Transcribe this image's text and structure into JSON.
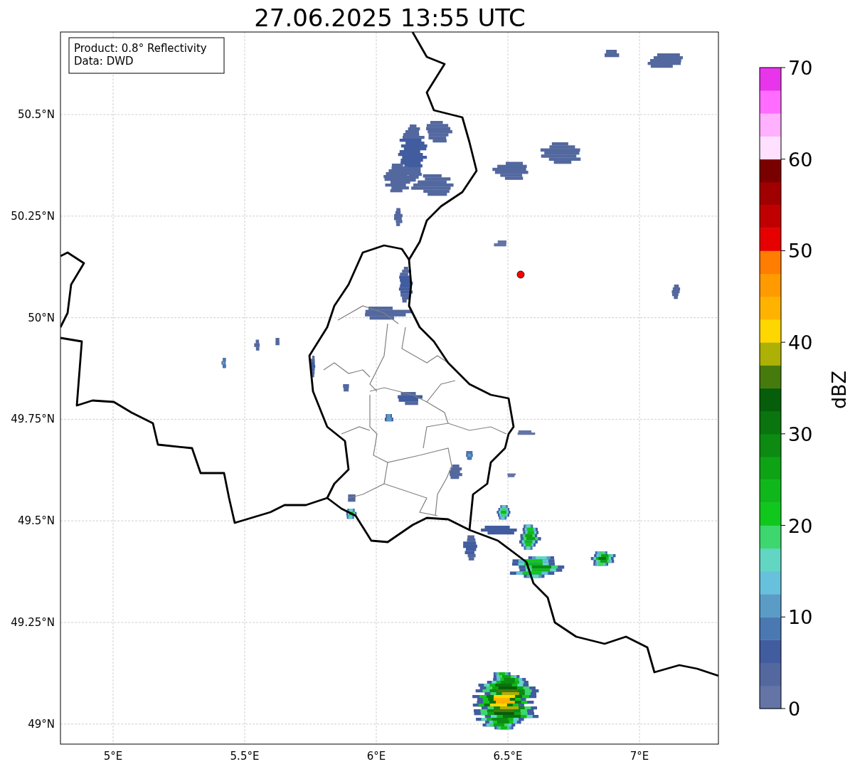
{
  "title": "27.06.2025 13:55 UTC",
  "legend": [
    "Product: 0.8° Reflectivity",
    "Data: DWD"
  ],
  "map": {
    "yticks": [
      "50.5°N",
      "50.25°N",
      "50°N",
      "49.75°N",
      "49.5°N",
      "49.25°N",
      "49°N"
    ],
    "xticks": [
      "5°E",
      "5.5°E",
      "6°E",
      "6.5°E",
      "7°E"
    ]
  },
  "colorbar": {
    "label": "dBZ",
    "ticks": [
      "70",
      "60",
      "50",
      "40",
      "30",
      "20",
      "10",
      "0"
    ],
    "bins": [
      {
        "color": "#6474a6"
      },
      {
        "color": "#53689f"
      },
      {
        "color": "#415c9f"
      },
      {
        "color": "#4a79b2"
      },
      {
        "color": "#5a9cc6"
      },
      {
        "color": "#67c1dc"
      },
      {
        "color": "#62d6c3"
      },
      {
        "color": "#3ed66e"
      },
      {
        "color": "#10c81c"
      },
      {
        "color": "#0fb81a"
      },
      {
        "color": "#0ea314"
      },
      {
        "color": "#0c8a12"
      },
      {
        "color": "#0a740e"
      },
      {
        "color": "#065e0a"
      },
      {
        "color": "#467a0c"
      },
      {
        "color": "#adb005"
      },
      {
        "color": "#ffd700"
      },
      {
        "color": "#ffb300"
      },
      {
        "color": "#ff9a00"
      },
      {
        "color": "#ff7d00"
      },
      {
        "color": "#e60000"
      },
      {
        "color": "#c00000"
      },
      {
        "color": "#a00000"
      },
      {
        "color": "#7a0000"
      },
      {
        "color": "#ffe0ff"
      },
      {
        "color": "#ffb0ff"
      },
      {
        "color": "#ff6cff"
      },
      {
        "color": "#e835ec"
      }
    ]
  }
}
